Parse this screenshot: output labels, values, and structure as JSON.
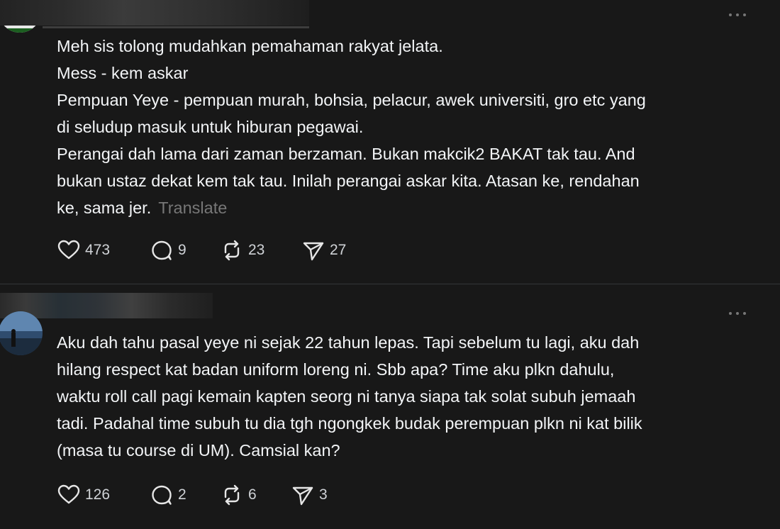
{
  "posts": [
    {
      "body_lines": [
        "Meh sis tolong mudahkan pemahaman rakyat jelata.",
        "Mess - kem askar",
        "Pempuan Yeye - pempuan murah, bohsia, pelacur, awek universiti, gro etc yang",
        "di seludup masuk untuk hiburan pegawai.",
        "Perangai dah lama dari zaman berzaman. Bukan makcik2 BAKAT tak tau. And",
        "bukan ustaz dekat kem tak tau. Inilah perangai askar kita. Atasan ke, rendahan",
        "ke, sama jer."
      ],
      "translate_label": "Translate",
      "likes": "473",
      "replies": "9",
      "reposts": "23",
      "shares": "27"
    },
    {
      "body_lines": [
        "Aku dah tahu pasal yeye ni sejak 22 tahun lepas. Tapi sebelum tu lagi, aku dah",
        "hilang respect kat badan uniform loreng ni. Sbb apa? Time aku plkn dahulu,",
        "waktu roll call pagi kemain kapten seorg ni tanya siapa tak solat subuh jemaah",
        "tadi. Padahal time subuh tu dia tgh ngongkek budak perempuan plkn ni kat bilik",
        "(masa tu course di UM). Camsial kan?"
      ],
      "likes": "126",
      "replies": "2",
      "reposts": "6",
      "shares": "3"
    }
  ],
  "icons": {
    "like": "heart-icon",
    "reply": "comment-icon",
    "repost": "repost-icon",
    "share": "send-icon",
    "more": "more-options-icon"
  },
  "colors": {
    "background": "#181818",
    "text": "#f3f5f7",
    "muted": "#777777",
    "divider": "#333638"
  }
}
